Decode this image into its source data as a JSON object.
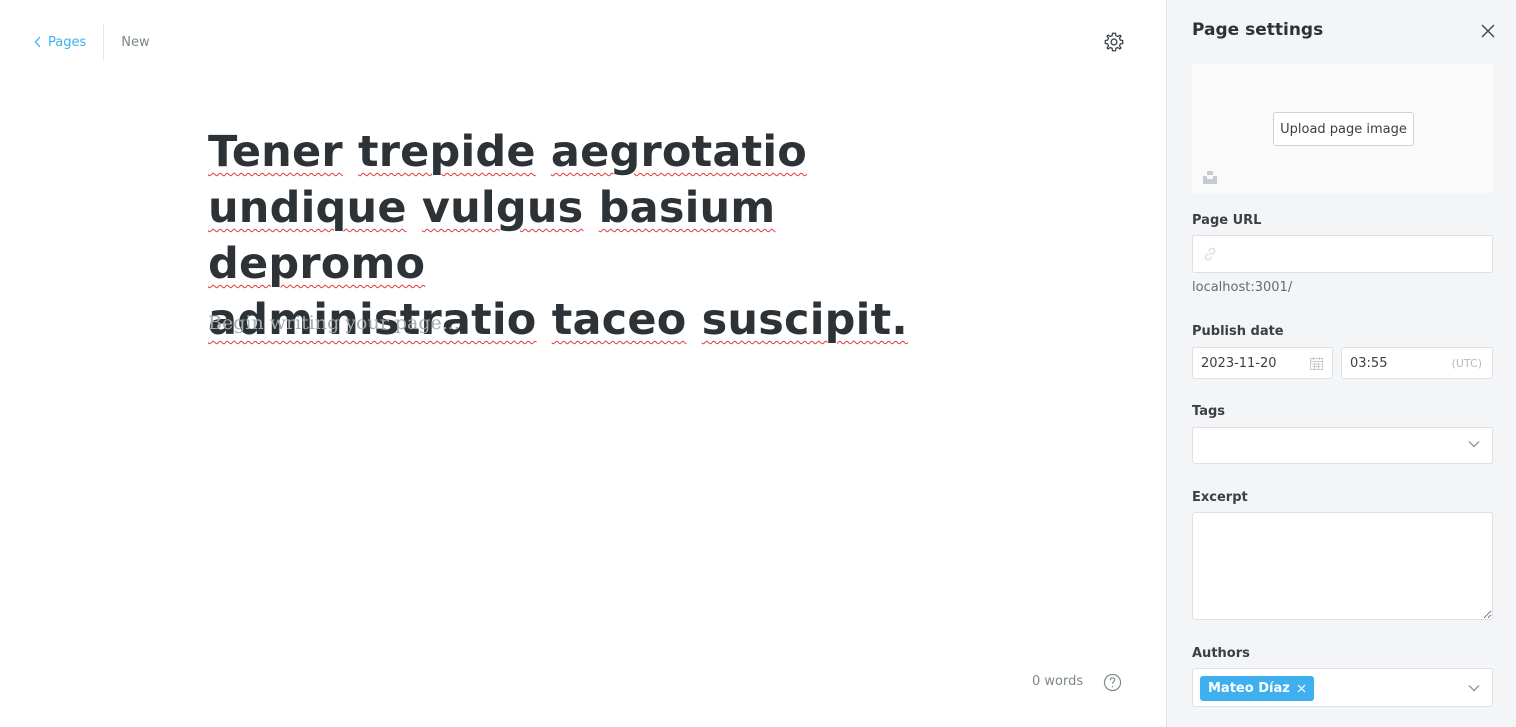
{
  "header": {
    "back_label": "Pages",
    "status": "New"
  },
  "editor": {
    "title_words": [
      "Tener",
      "trepide",
      "aegrotatio",
      "undique",
      "vulgus",
      "basium",
      "depromo",
      "administratio",
      "taceo",
      "suscipit."
    ],
    "body_placeholder": "Begin writing your page...",
    "word_count": "0 words"
  },
  "settings": {
    "title": "Page settings",
    "upload_label": "Upload page image",
    "url_label": "Page URL",
    "url_value": "",
    "url_hint": "localhost:3001/",
    "publish_label": "Publish date",
    "publish_date": "2023-11-20",
    "publish_time": "03:55",
    "timezone": "(UTC)",
    "tags_label": "Tags",
    "excerpt_label": "Excerpt",
    "excerpt_value": "",
    "authors_label": "Authors",
    "authors": [
      "Mateo Díaz"
    ]
  },
  "colors": {
    "accent": "#3eb0ef",
    "spellcheck": "#e0393e"
  },
  "icons": [
    "chevron-left-icon",
    "gear-icon",
    "help-icon",
    "close-icon",
    "unsplash-icon",
    "link-icon",
    "calendar-icon",
    "chevron-down-icon",
    "remove-icon"
  ]
}
